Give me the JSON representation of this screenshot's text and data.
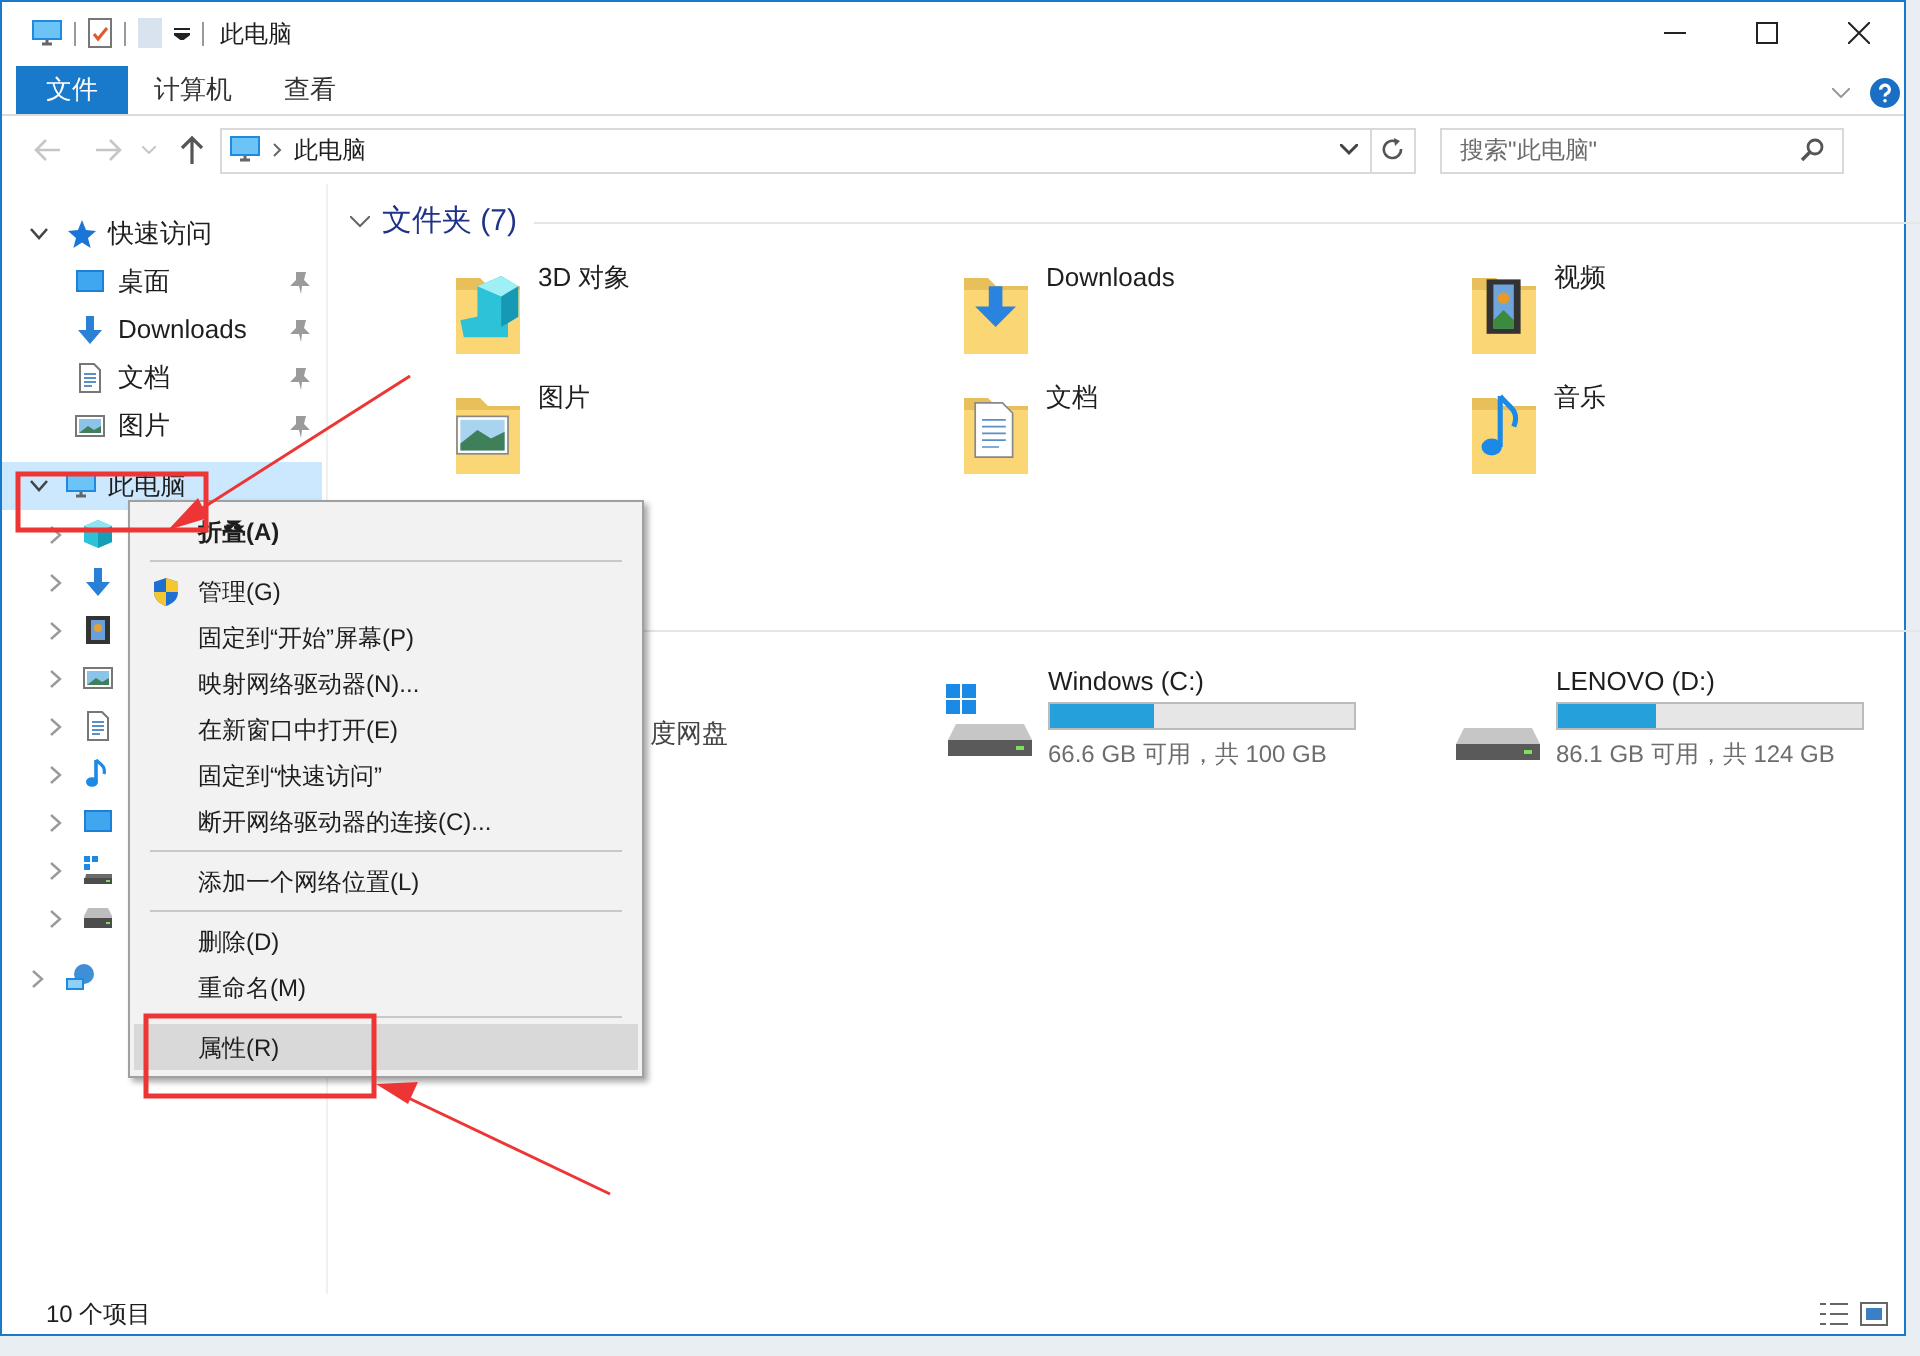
{
  "title_bar": {
    "title": "此电脑"
  },
  "ribbon_tabs": [
    {
      "label": "文件",
      "selected": true
    },
    {
      "label": "计算机",
      "selected": false
    },
    {
      "label": "查看",
      "selected": false
    }
  ],
  "address_bar": {
    "path": [
      "此电脑"
    ]
  },
  "search": {
    "placeholder": "搜索\"此电脑\""
  },
  "navigation": [
    {
      "label": "快速访问",
      "kind": "star",
      "expanded": true,
      "selected": false,
      "children": [
        {
          "label": "桌面",
          "kind": "desktop",
          "pinned": true,
          "selected": false
        },
        {
          "label": "Downloads",
          "kind": "download",
          "pinned": true,
          "selected": false
        },
        {
          "label": "文档",
          "kind": "document",
          "pinned": true,
          "selected": false
        },
        {
          "label": "图片",
          "kind": "picture-file",
          "pinned": true,
          "selected": false
        }
      ]
    },
    {
      "label": "此电脑",
      "kind": "computer",
      "expanded": true,
      "selected": true,
      "children": [
        {
          "kind": "cube",
          "expanded": false,
          "selected": false
        },
        {
          "kind": "download",
          "expanded": false,
          "selected": false
        },
        {
          "kind": "video",
          "expanded": false,
          "selected": false
        },
        {
          "kind": "picture-file",
          "expanded": false,
          "selected": false
        },
        {
          "kind": "document",
          "expanded": false,
          "selected": false
        },
        {
          "kind": "music",
          "expanded": false,
          "selected": false
        },
        {
          "kind": "desktop",
          "expanded": false,
          "selected": false
        },
        {
          "kind": "windows-drive",
          "expanded": false,
          "selected": false
        },
        {
          "kind": "drive",
          "expanded": false,
          "selected": false
        }
      ]
    },
    {
      "kind": "network",
      "expanded": false,
      "selected": false
    }
  ],
  "folders": {
    "title": "文件夹 (7)",
    "expanded": true,
    "items": [
      {
        "label": "3D 对象",
        "kind": "cube"
      },
      {
        "label": "Downloads",
        "kind": "download"
      },
      {
        "label": "视频",
        "kind": "video"
      },
      {
        "label": "图片",
        "kind": "picture-file"
      },
      {
        "label": "文档",
        "kind": "document"
      },
      {
        "label": "音乐",
        "kind": "music"
      }
    ]
  },
  "drives": [
    {
      "label": "度网盘",
      "kind": "cloud"
    },
    {
      "label": "Windows (C:)",
      "kind": "windows-drive",
      "level": 0.34,
      "space": "66.6 GB 可用，共 100 GB"
    },
    {
      "label": "LENOVO (D:)",
      "kind": "drive",
      "level": 0.32,
      "space": "86.1 GB 可用，共 124 GB"
    }
  ],
  "context_menu": [
    {
      "kind": "item",
      "label": "折叠(A)",
      "bold": true,
      "shield": false,
      "selected": false
    },
    {
      "kind": "separator"
    },
    {
      "kind": "item",
      "label": "管理(G)",
      "bold": false,
      "shield": true,
      "selected": false
    },
    {
      "kind": "item",
      "label": "固定到“开始”屏幕(P)",
      "bold": false,
      "shield": false,
      "selected": false
    },
    {
      "kind": "item",
      "label": "映射网络驱动器(N)...",
      "bold": false,
      "shield": false,
      "selected": false
    },
    {
      "kind": "item",
      "label": "在新窗口中打开(E)",
      "bold": false,
      "shield": false,
      "selected": false
    },
    {
      "kind": "item",
      "label": "固定到“快速访问”",
      "bold": false,
      "shield": false,
      "selected": false
    },
    {
      "kind": "item",
      "label": "断开网络驱动器的连接(C)...",
      "bold": false,
      "shield": false,
      "selected": false
    },
    {
      "kind": "separator"
    },
    {
      "kind": "item",
      "label": "添加一个网络位置(L)",
      "bold": false,
      "shield": false,
      "selected": false
    },
    {
      "kind": "separator"
    },
    {
      "kind": "item",
      "label": "删除(D)",
      "bold": false,
      "shield": false,
      "selected": false
    },
    {
      "kind": "item",
      "label": "重命名(M)",
      "bold": false,
      "shield": false,
      "selected": false
    },
    {
      "kind": "separator"
    },
    {
      "kind": "item",
      "label": "属性(R)",
      "bold": false,
      "shield": false,
      "selected": true
    }
  ],
  "status_bar": {
    "count": "10 个项目"
  }
}
